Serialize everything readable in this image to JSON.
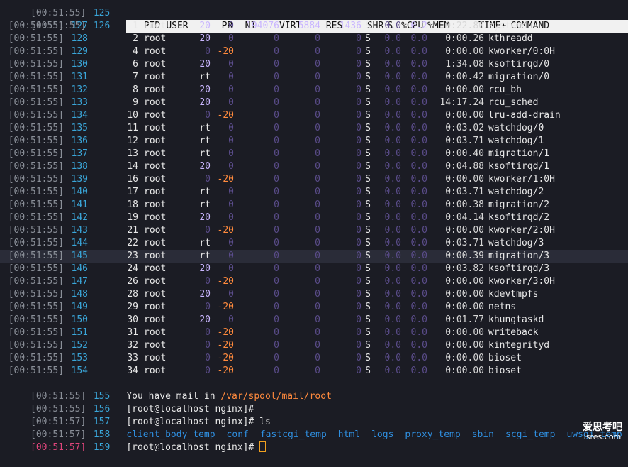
{
  "header": {
    "pid": "PID",
    "user": "USER",
    "pr": "PR",
    "ni": "NI",
    "virt": "VIRT",
    "res": "RES",
    "shr": "SHR",
    "s": "S",
    "cpu": "%CPU",
    "mem": "%MEM",
    "time": "TIME+",
    "command": "COMMAND"
  },
  "header_line": {
    "ts": "[00:51:55]",
    "ln": "126"
  },
  "first_line": {
    "ts": "[00:51:55]",
    "ln": "125"
  },
  "processes": [
    {
      "ts": "[00:51:55]",
      "ln": "127",
      "pid": "1",
      "user": "root",
      "pr": "20",
      "ni": "0",
      "virt": "194076",
      "res": "5884",
      "shr": "1436",
      "s": "S",
      "cpu": "0.0",
      "mem": "0.2",
      "time": "0:22.80",
      "command": "systemd"
    },
    {
      "ts": "[00:51:55]",
      "ln": "128",
      "pid": "2",
      "user": "root",
      "pr": "20",
      "ni": "0",
      "virt": "0",
      "res": "0",
      "shr": "0",
      "s": "S",
      "cpu": "0.0",
      "mem": "0.0",
      "time": "0:00.26",
      "command": "kthreadd"
    },
    {
      "ts": "[00:51:55]",
      "ln": "129",
      "pid": "4",
      "user": "root",
      "pr": "0",
      "ni": "-20",
      "virt": "0",
      "res": "0",
      "shr": "0",
      "s": "S",
      "cpu": "0.0",
      "mem": "0.0",
      "time": "0:00.00",
      "command": "kworker/0:0H"
    },
    {
      "ts": "[00:51:55]",
      "ln": "130",
      "pid": "6",
      "user": "root",
      "pr": "20",
      "ni": "0",
      "virt": "0",
      "res": "0",
      "shr": "0",
      "s": "S",
      "cpu": "0.0",
      "mem": "0.0",
      "time": "1:34.08",
      "command": "ksoftirqd/0"
    },
    {
      "ts": "[00:51:55]",
      "ln": "131",
      "pid": "7",
      "user": "root",
      "pr": "rt",
      "ni": "0",
      "virt": "0",
      "res": "0",
      "shr": "0",
      "s": "S",
      "cpu": "0.0",
      "mem": "0.0",
      "time": "0:00.42",
      "command": "migration/0"
    },
    {
      "ts": "[00:51:55]",
      "ln": "132",
      "pid": "8",
      "user": "root",
      "pr": "20",
      "ni": "0",
      "virt": "0",
      "res": "0",
      "shr": "0",
      "s": "S",
      "cpu": "0.0",
      "mem": "0.0",
      "time": "0:00.00",
      "command": "rcu_bh"
    },
    {
      "ts": "[00:51:55]",
      "ln": "133",
      "pid": "9",
      "user": "root",
      "pr": "20",
      "ni": "0",
      "virt": "0",
      "res": "0",
      "shr": "0",
      "s": "S",
      "cpu": "0.0",
      "mem": "0.0",
      "time": "14:17.24",
      "command": "rcu_sched"
    },
    {
      "ts": "[00:51:55]",
      "ln": "134",
      "pid": "10",
      "user": "root",
      "pr": "0",
      "ni": "-20",
      "virt": "0",
      "res": "0",
      "shr": "0",
      "s": "S",
      "cpu": "0.0",
      "mem": "0.0",
      "time": "0:00.00",
      "command": "lru-add-drain"
    },
    {
      "ts": "[00:51:55]",
      "ln": "135",
      "pid": "11",
      "user": "root",
      "pr": "rt",
      "ni": "0",
      "virt": "0",
      "res": "0",
      "shr": "0",
      "s": "S",
      "cpu": "0.0",
      "mem": "0.0",
      "time": "0:03.02",
      "command": "watchdog/0"
    },
    {
      "ts": "[00:51:55]",
      "ln": "136",
      "pid": "12",
      "user": "root",
      "pr": "rt",
      "ni": "0",
      "virt": "0",
      "res": "0",
      "shr": "0",
      "s": "S",
      "cpu": "0.0",
      "mem": "0.0",
      "time": "0:03.71",
      "command": "watchdog/1"
    },
    {
      "ts": "[00:51:55]",
      "ln": "137",
      "pid": "13",
      "user": "root",
      "pr": "rt",
      "ni": "0",
      "virt": "0",
      "res": "0",
      "shr": "0",
      "s": "S",
      "cpu": "0.0",
      "mem": "0.0",
      "time": "0:00.40",
      "command": "migration/1"
    },
    {
      "ts": "[00:51:55]",
      "ln": "138",
      "pid": "14",
      "user": "root",
      "pr": "20",
      "ni": "0",
      "virt": "0",
      "res": "0",
      "shr": "0",
      "s": "S",
      "cpu": "0.0",
      "mem": "0.0",
      "time": "0:04.88",
      "command": "ksoftirqd/1"
    },
    {
      "ts": "[00:51:55]",
      "ln": "139",
      "pid": "16",
      "user": "root",
      "pr": "0",
      "ni": "-20",
      "virt": "0",
      "res": "0",
      "shr": "0",
      "s": "S",
      "cpu": "0.0",
      "mem": "0.0",
      "time": "0:00.00",
      "command": "kworker/1:0H"
    },
    {
      "ts": "[00:51:55]",
      "ln": "140",
      "pid": "17",
      "user": "root",
      "pr": "rt",
      "ni": "0",
      "virt": "0",
      "res": "0",
      "shr": "0",
      "s": "S",
      "cpu": "0.0",
      "mem": "0.0",
      "time": "0:03.71",
      "command": "watchdog/2"
    },
    {
      "ts": "[00:51:55]",
      "ln": "141",
      "pid": "18",
      "user": "root",
      "pr": "rt",
      "ni": "0",
      "virt": "0",
      "res": "0",
      "shr": "0",
      "s": "S",
      "cpu": "0.0",
      "mem": "0.0",
      "time": "0:00.38",
      "command": "migration/2"
    },
    {
      "ts": "[00:51:55]",
      "ln": "142",
      "pid": "19",
      "user": "root",
      "pr": "20",
      "ni": "0",
      "virt": "0",
      "res": "0",
      "shr": "0",
      "s": "S",
      "cpu": "0.0",
      "mem": "0.0",
      "time": "0:04.14",
      "command": "ksoftirqd/2"
    },
    {
      "ts": "[00:51:55]",
      "ln": "143",
      "pid": "21",
      "user": "root",
      "pr": "0",
      "ni": "-20",
      "virt": "0",
      "res": "0",
      "shr": "0",
      "s": "S",
      "cpu": "0.0",
      "mem": "0.0",
      "time": "0:00.00",
      "command": "kworker/2:0H"
    },
    {
      "ts": "[00:51:55]",
      "ln": "144",
      "pid": "22",
      "user": "root",
      "pr": "rt",
      "ni": "0",
      "virt": "0",
      "res": "0",
      "shr": "0",
      "s": "S",
      "cpu": "0.0",
      "mem": "0.0",
      "time": "0:03.71",
      "command": "watchdog/3"
    },
    {
      "ts": "[00:51:55]",
      "ln": "145",
      "pid": "23",
      "user": "root",
      "pr": "rt",
      "ni": "0",
      "virt": "0",
      "res": "0",
      "shr": "0",
      "s": "S",
      "cpu": "0.0",
      "mem": "0.0",
      "time": "0:00.39",
      "command": "migration/3",
      "highlight": true
    },
    {
      "ts": "[00:51:55]",
      "ln": "146",
      "pid": "24",
      "user": "root",
      "pr": "20",
      "ni": "0",
      "virt": "0",
      "res": "0",
      "shr": "0",
      "s": "S",
      "cpu": "0.0",
      "mem": "0.0",
      "time": "0:03.82",
      "command": "ksoftirqd/3"
    },
    {
      "ts": "[00:51:55]",
      "ln": "147",
      "pid": "26",
      "user": "root",
      "pr": "0",
      "ni": "-20",
      "virt": "0",
      "res": "0",
      "shr": "0",
      "s": "S",
      "cpu": "0.0",
      "mem": "0.0",
      "time": "0:00.00",
      "command": "kworker/3:0H"
    },
    {
      "ts": "[00:51:55]",
      "ln": "148",
      "pid": "28",
      "user": "root",
      "pr": "20",
      "ni": "0",
      "virt": "0",
      "res": "0",
      "shr": "0",
      "s": "S",
      "cpu": "0.0",
      "mem": "0.0",
      "time": "0:00.00",
      "command": "kdevtmpfs"
    },
    {
      "ts": "[00:51:55]",
      "ln": "149",
      "pid": "29",
      "user": "root",
      "pr": "0",
      "ni": "-20",
      "virt": "0",
      "res": "0",
      "shr": "0",
      "s": "S",
      "cpu": "0.0",
      "mem": "0.0",
      "time": "0:00.00",
      "command": "netns"
    },
    {
      "ts": "[00:51:55]",
      "ln": "150",
      "pid": "30",
      "user": "root",
      "pr": "20",
      "ni": "0",
      "virt": "0",
      "res": "0",
      "shr": "0",
      "s": "S",
      "cpu": "0.0",
      "mem": "0.0",
      "time": "0:01.77",
      "command": "khungtaskd"
    },
    {
      "ts": "[00:51:55]",
      "ln": "151",
      "pid": "31",
      "user": "root",
      "pr": "0",
      "ni": "-20",
      "virt": "0",
      "res": "0",
      "shr": "0",
      "s": "S",
      "cpu": "0.0",
      "mem": "0.0",
      "time": "0:00.00",
      "command": "writeback"
    },
    {
      "ts": "[00:51:55]",
      "ln": "152",
      "pid": "32",
      "user": "root",
      "pr": "0",
      "ni": "-20",
      "virt": "0",
      "res": "0",
      "shr": "0",
      "s": "S",
      "cpu": "0.0",
      "mem": "0.0",
      "time": "0:00.00",
      "command": "kintegrityd"
    },
    {
      "ts": "[00:51:55]",
      "ln": "153",
      "pid": "33",
      "user": "root",
      "pr": "0",
      "ni": "-20",
      "virt": "0",
      "res": "0",
      "shr": "0",
      "s": "S",
      "cpu": "0.0",
      "mem": "0.0",
      "time": "0:00.00",
      "command": "bioset"
    },
    {
      "ts": "[00:51:55]",
      "ln": "154",
      "pid": "34",
      "user": "root",
      "pr": "0",
      "ni": "-20",
      "virt": "0",
      "res": "0",
      "shr": "0",
      "s": "S",
      "cpu": "0.0",
      "mem": "0.0",
      "time": "0:00.00",
      "command": "bioset"
    }
  ],
  "mail": {
    "ts": "[00:51:55]",
    "ln": "155",
    "prefix": "You have mail in ",
    "path": "/var/spool/mail/root"
  },
  "prompt1": {
    "ts": "[00:51:55]",
    "ln": "156",
    "text": "[root@localhost nginx]#"
  },
  "prompt2": {
    "ts": "[00:51:57]",
    "ln": "157",
    "text": "[root@localhost nginx]# ls"
  },
  "ls_output": {
    "ts": "[00:51:57]",
    "ln": "158",
    "dirs": [
      "client_body_temp",
      "conf",
      "fastcgi_temp",
      "html",
      "logs",
      "proxy_temp",
      "sbin",
      "scgi_temp",
      "uwsgi_temp"
    ]
  },
  "prompt3": {
    "ts": "[00:51:57]",
    "ln": "159",
    "text": "[root@localhost nginx]# "
  },
  "watermark": {
    "line1": "爱思考吧",
    "line2": "isres.com"
  }
}
